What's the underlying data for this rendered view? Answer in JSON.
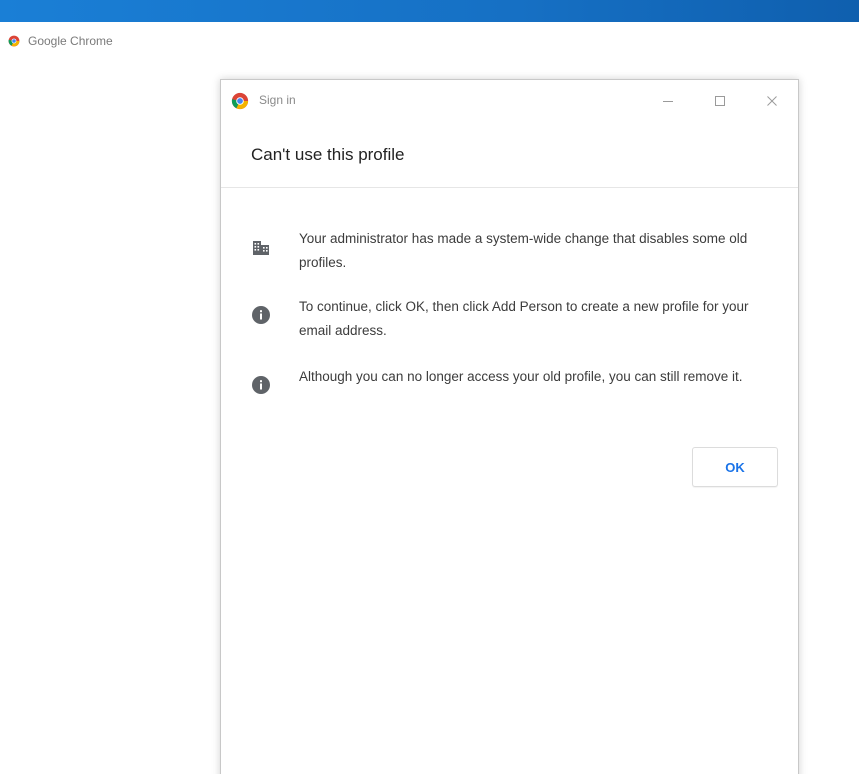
{
  "taskbar": {
    "app_label": "Google Chrome"
  },
  "dialog": {
    "window_title": "Sign in",
    "heading": "Can't use this profile",
    "messages": [
      {
        "icon": "building-icon",
        "text": "Your administrator has made a system-wide change that disables some old profiles."
      },
      {
        "icon": "info-icon",
        "text": "To continue, click OK, then click Add Person to create a new profile for your email address."
      },
      {
        "icon": "info-icon",
        "text": "Although you can no longer access your old profile, you can still remove it."
      }
    ],
    "ok_label": "OK"
  },
  "colors": {
    "accent": "#1a73e8",
    "top_bar": "#1670c4",
    "icon": "#5f6368"
  }
}
